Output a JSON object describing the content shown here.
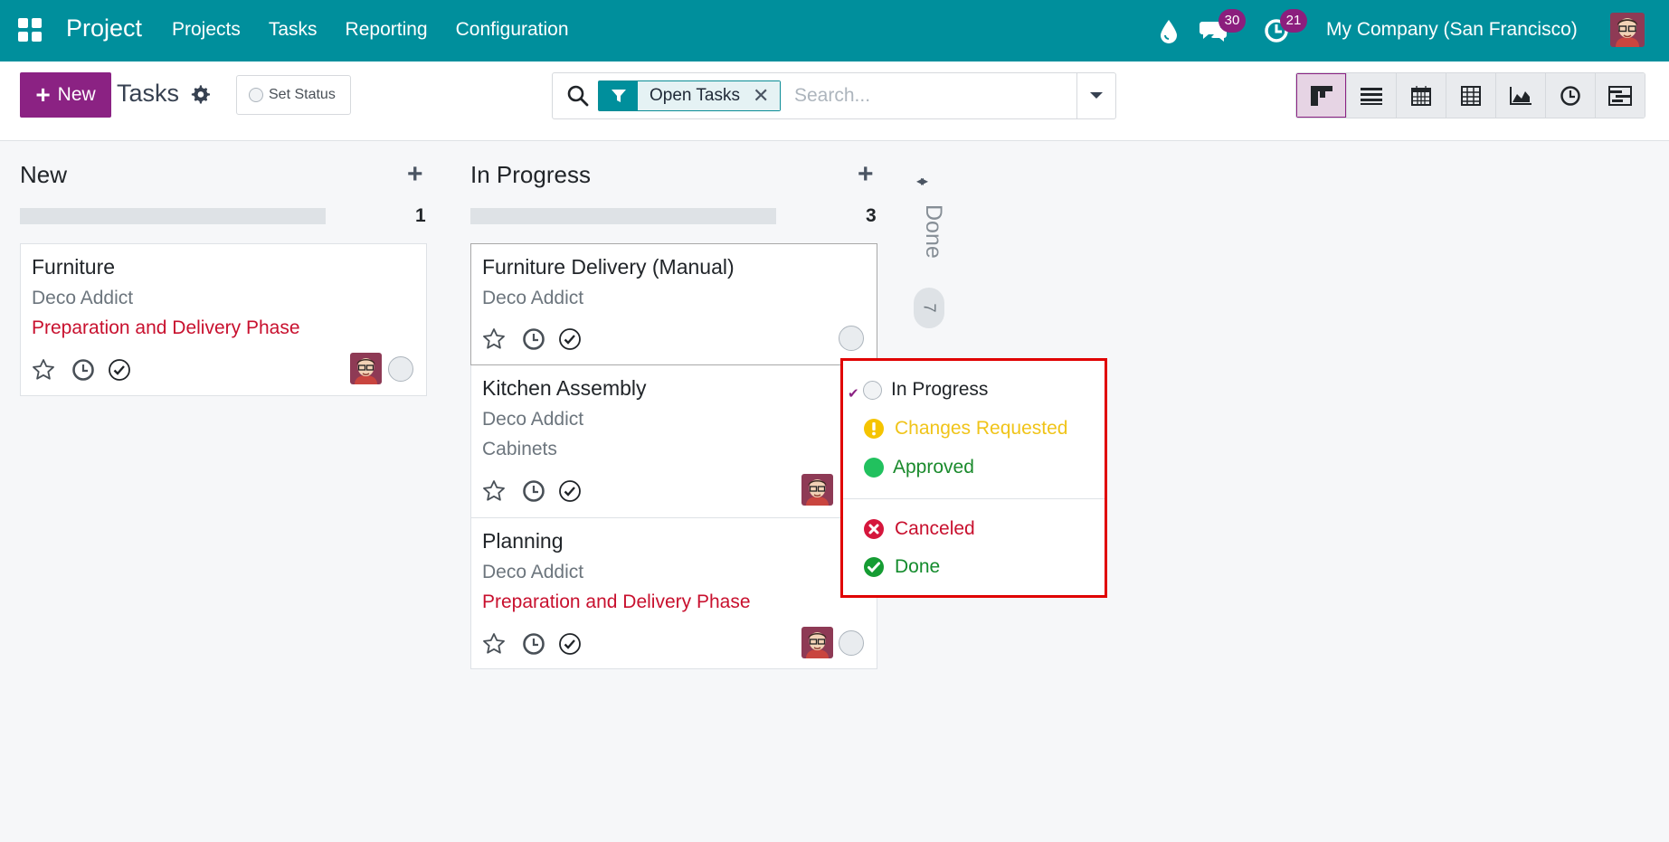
{
  "colors": {
    "navbar": "#008f9c",
    "primary": "#8b2283",
    "danger": "#c8102e",
    "success": "#159c33",
    "warning": "#f5c400",
    "highlight_border": "#e00000"
  },
  "navbar": {
    "app_name": "Project",
    "menu": [
      "Projects",
      "Tasks",
      "Reporting",
      "Configuration"
    ],
    "messages_count": "30",
    "activities_count": "21",
    "company": "My Company (San Francisco)"
  },
  "control": {
    "new_label": "New",
    "title": "Tasks",
    "set_status_label": "Set Status",
    "filter_facet": "Open Tasks",
    "search_placeholder": "Search...",
    "views": [
      "kanban",
      "list",
      "calendar",
      "pivot",
      "graph",
      "activity",
      "gantt"
    ]
  },
  "columns": [
    {
      "title": "New",
      "count": "1",
      "cards": [
        {
          "title": "Furniture",
          "customer": "Deco Addict",
          "tag": "Preparation and Delivery Phase"
        }
      ]
    },
    {
      "title": "In Progress",
      "count": "3",
      "cards": [
        {
          "title": "Furniture Delivery (Manual)",
          "customer": "Deco Addict"
        },
        {
          "title": "Kitchen Assembly",
          "customer": "Deco Addict",
          "tag": "Cabinets"
        },
        {
          "title": "Planning",
          "customer": "Deco Addict",
          "tag": "Preparation and Delivery Phase"
        }
      ]
    }
  ],
  "folded_column": {
    "title": "Done",
    "count": "7"
  },
  "status_dropdown": {
    "items": [
      {
        "label": "In Progress",
        "selected": true
      },
      {
        "label": "Changes Requested"
      },
      {
        "label": "Approved"
      },
      {
        "label": "Canceled"
      },
      {
        "label": "Done"
      }
    ]
  }
}
